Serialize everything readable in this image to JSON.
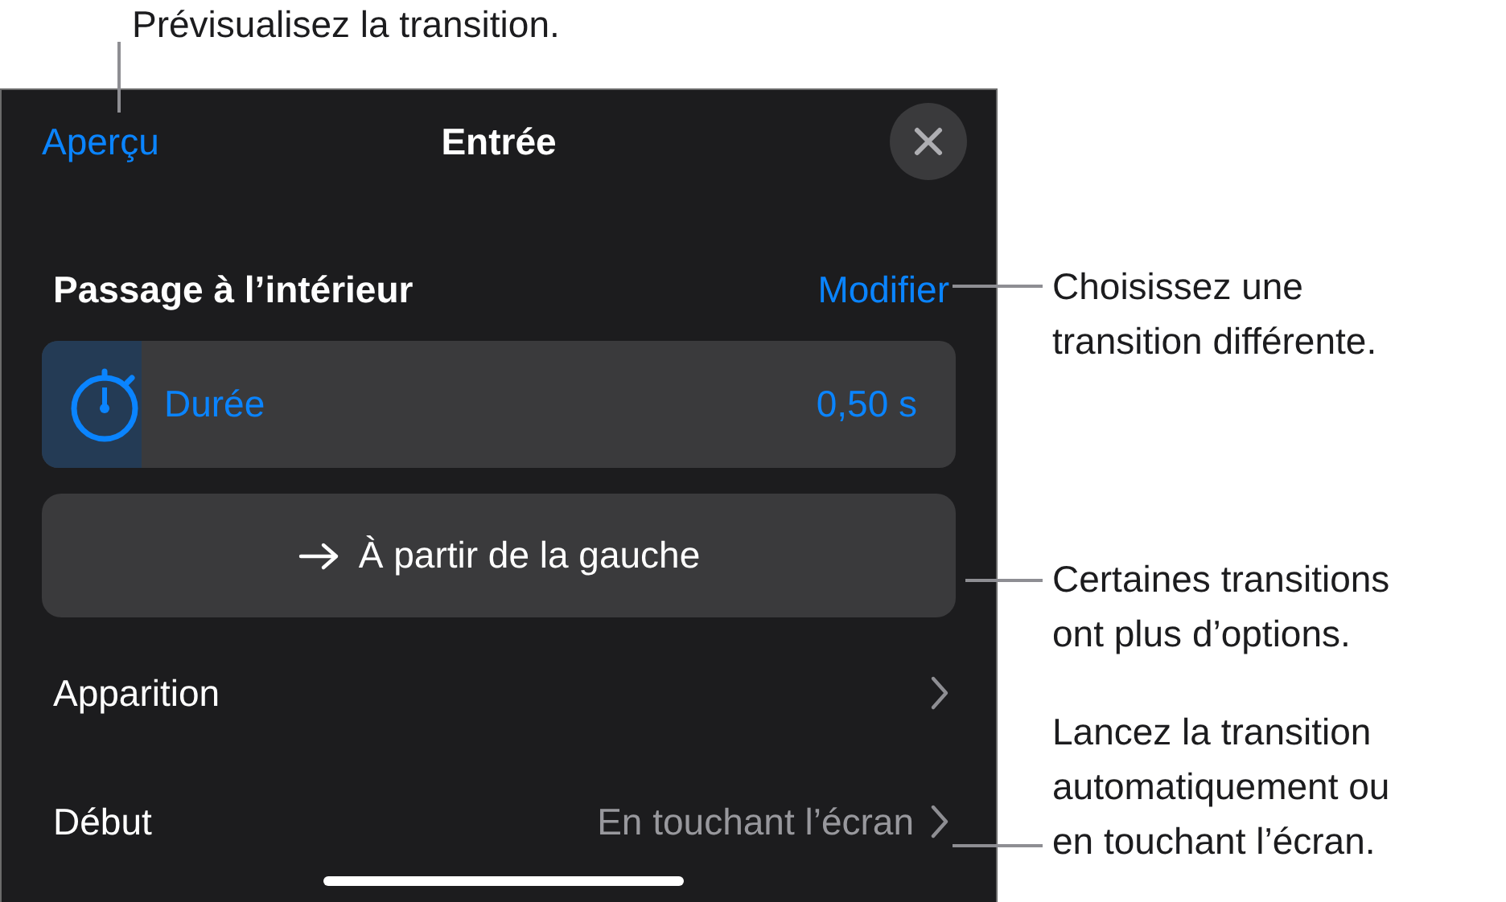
{
  "callouts": [
    {
      "kind": "top",
      "lines": [
        "Prévisualisez la transition."
      ]
    },
    {
      "kind": "modify",
      "lines": [
        "Choisissez une",
        "transition différente."
      ]
    },
    {
      "kind": "options",
      "lines": [
        "Certaines transitions",
        "ont plus d’options."
      ]
    },
    {
      "kind": "start",
      "lines": [
        "Lancez la transition",
        "automatiquement ou",
        "en touchant l’écran."
      ]
    }
  ],
  "header": {
    "preview": "Aperçu",
    "title": "Entrée"
  },
  "effect": {
    "name": "Passage à l’intérieur",
    "action": "Modifier"
  },
  "duration": {
    "label": "Durée",
    "reading": "0,50 s",
    "level": 0.11
  },
  "direction": {
    "label": "À partir de la gauche"
  },
  "rows": [
    {
      "label": "Apparition"
    },
    {
      "label": "Début",
      "value": "En touchant l’écran"
    }
  ]
}
